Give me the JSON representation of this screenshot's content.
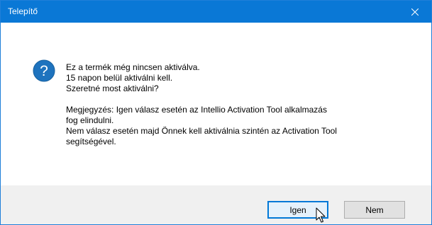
{
  "window": {
    "title": "Telepítő"
  },
  "dialog": {
    "icon": "question-icon",
    "lines": [
      "Ez a termék még nincsen aktiválva.",
      "15 napon belül aktiválni kell.",
      "Szeretné most aktiválni?",
      "",
      "Megjegyzés: Igen válasz esetén az Intellio Activation Tool alkalmazás",
      "fog elindulni.",
      "Nem válasz esetén majd Önnek kell aktiválnia szintén az Activation Tool",
      "segítségével."
    ]
  },
  "buttons": {
    "yes_label": "Igen",
    "no_label": "Nem"
  },
  "colors": {
    "titlebar": "#0a78d6",
    "accent": "#0078d7",
    "icon": "#1e73be"
  }
}
